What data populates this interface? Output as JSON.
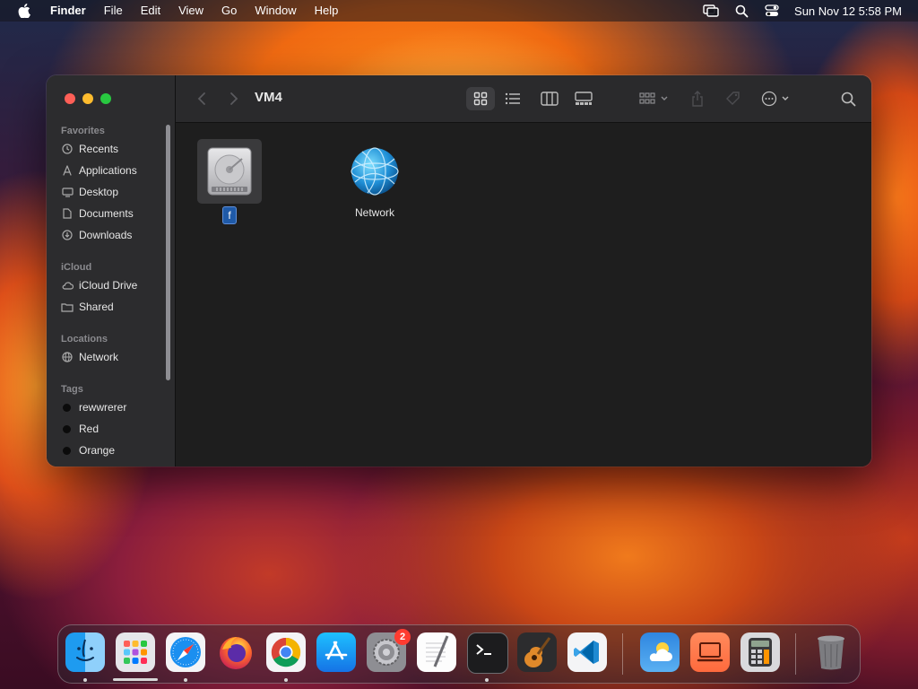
{
  "menubar": {
    "app_name": "Finder",
    "items": [
      "File",
      "Edit",
      "View",
      "Go",
      "Window",
      "Help"
    ],
    "clock": "Sun Nov 12  5:58 PM"
  },
  "window": {
    "title": "VM4",
    "sidebar": {
      "favorites_header": "Favorites",
      "favorites": [
        "Recents",
        "Applications",
        "Desktop",
        "Documents",
        "Downloads"
      ],
      "icloud_header": "iCloud",
      "icloud": [
        "iCloud Drive",
        "Shared"
      ],
      "locations_header": "Locations",
      "locations": [
        "Network"
      ],
      "tags_header": "Tags",
      "tags": [
        "rewwrerer",
        "Red",
        "Orange"
      ]
    },
    "files": [
      {
        "name": "f",
        "icon": "hard-drive-icon",
        "renaming": true
      },
      {
        "name": "Network",
        "icon": "network-globe-icon",
        "renaming": false
      }
    ]
  },
  "dock": {
    "apps": [
      "Finder",
      "Launchpad",
      "Safari",
      "Firefox",
      "Chrome",
      "App Store",
      "System Settings",
      "TextEdit",
      "Terminal",
      "GarageBand",
      "Visual Studio Code",
      "Weather",
      "Screen Sharing",
      "Calculator",
      "Trash"
    ],
    "system_settings_badge": "2"
  },
  "colors": {
    "accent": "#1f5aa8",
    "close": "#fe5f57",
    "minimize": "#febc2e",
    "zoom": "#28c840",
    "badge": "#ff3b30"
  }
}
